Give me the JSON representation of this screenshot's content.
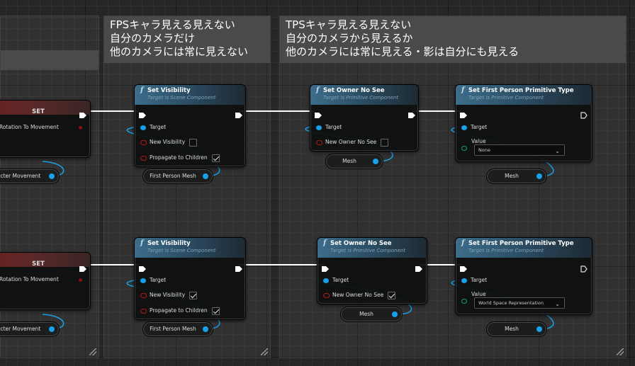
{
  "comments": {
    "fps": {
      "lines": "FPSキャラ見える見えない\n自分のカメラだけ\n他のカメラには常に見えない"
    },
    "tps": {
      "lines": "TPSキャラ見える見えない\n自分のカメラから見えるか\n他のカメラには常に見える・影は自分にも見える"
    }
  },
  "left_nodes": {
    "set_label": "SET",
    "rotation_label": "Rotation To Movement",
    "char_movement_label": "racter Movement"
  },
  "set_visibility": {
    "title": "Set Visibility",
    "subtitle": "Target is Scene Component",
    "target": "Target",
    "new_visibility": "New Visibility",
    "propagate": "Propagate to Children",
    "mesh_var": "First Person Mesh",
    "row1_new_visibility": false,
    "row1_propagate": true,
    "row2_new_visibility": true,
    "row2_propagate": true
  },
  "set_owner_no_see": {
    "title": "Set Owner No See",
    "subtitle": "Target is Primitive Component",
    "target": "Target",
    "new_owner_no_see": "New Owner No See",
    "mesh_var": "Mesh",
    "row1_value": false,
    "row2_value": true
  },
  "set_fp_primitive": {
    "title": "Set First Person Primitive Type",
    "subtitle": "Target is Primitive Component",
    "target": "Target",
    "value": "Value",
    "row1_option": "None",
    "row2_option": "World Space Representation",
    "mesh_var": "Mesh"
  },
  "icons": {
    "function": "f",
    "dropdown": "⌄"
  },
  "colors": {
    "function_header": "#3d6d8a",
    "set_header": "#6a2020",
    "object_pin": "#18a0e8",
    "bool_pin": "#b81818",
    "byte_pin": "#1a9a7a",
    "exec_wire": "#ffffff"
  }
}
